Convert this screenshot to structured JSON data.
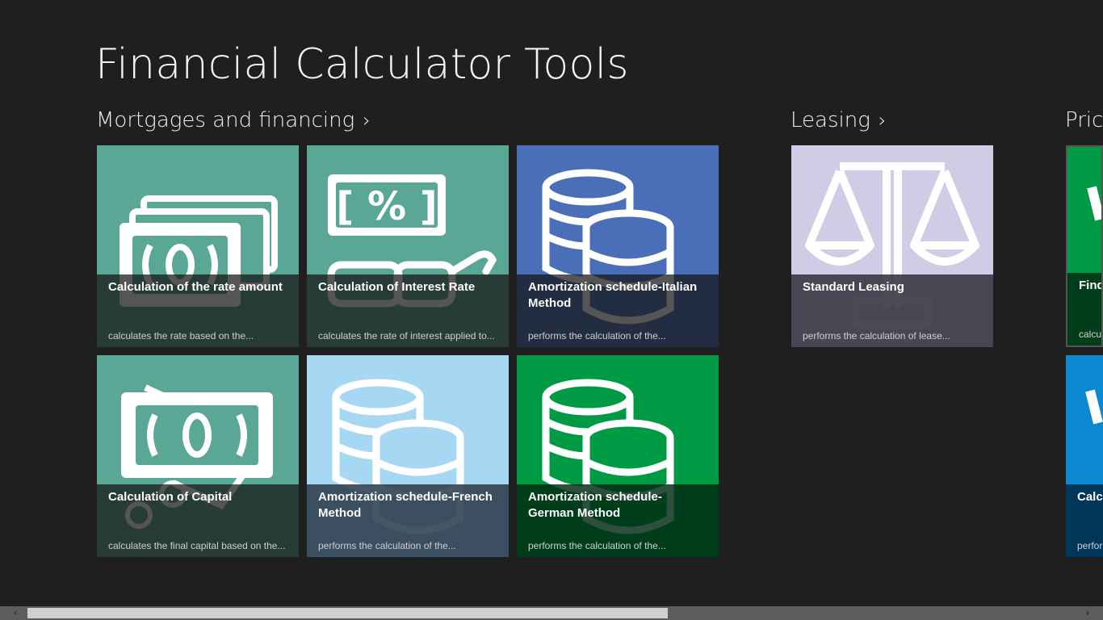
{
  "app": {
    "title": "Financial Calculator Tools"
  },
  "groups": [
    {
      "label": "Mortgages and financing",
      "chevron": "›"
    },
    {
      "label": "Leasing",
      "chevron": "›"
    },
    {
      "label": "Prices",
      "chevron": ""
    }
  ],
  "tiles": [
    {
      "title": "Calculation of the rate amount",
      "desc": "calculates the rate based on the...",
      "color": "#5aa795",
      "icon": "banknotes-icon"
    },
    {
      "title": "Calculation of Interest Rate",
      "desc": "calculates the rate of interest applied to...",
      "color": "#5aa795",
      "icon": "percent-glasses-icon"
    },
    {
      "title": "Amortization schedule-Italian Method",
      "desc": "performs the calculation of the...",
      "color": "#4a6fb8",
      "icon": "coins-icon"
    },
    {
      "title": "Calculation of Capital",
      "desc": "calculates the final capital based on the...",
      "color": "#5aa795",
      "icon": "banknote-icon"
    },
    {
      "title": "Amortization schedule-French Method",
      "desc": "performs the calculation of the...",
      "color": "#a6d8f3",
      "icon": "coins-icon"
    },
    {
      "title": "Amortization schedule-German Method",
      "desc": "performs the calculation of the...",
      "color": "#009a45",
      "icon": "coins-icon"
    },
    {
      "title": "Standard Leasing",
      "desc": "performs the calculation of lease...",
      "color": "#cfcde6",
      "icon": "scales-icon"
    },
    {
      "title": "Find",
      "desc": "calcula",
      "color": "#009a45",
      "icon": "check-icon"
    },
    {
      "title": "Calcu",
      "desc": "perfor",
      "color": "#0a88d0",
      "icon": "check-icon"
    }
  ],
  "scrollbar": {
    "left_arrow": "‹",
    "right_arrow": "›"
  }
}
